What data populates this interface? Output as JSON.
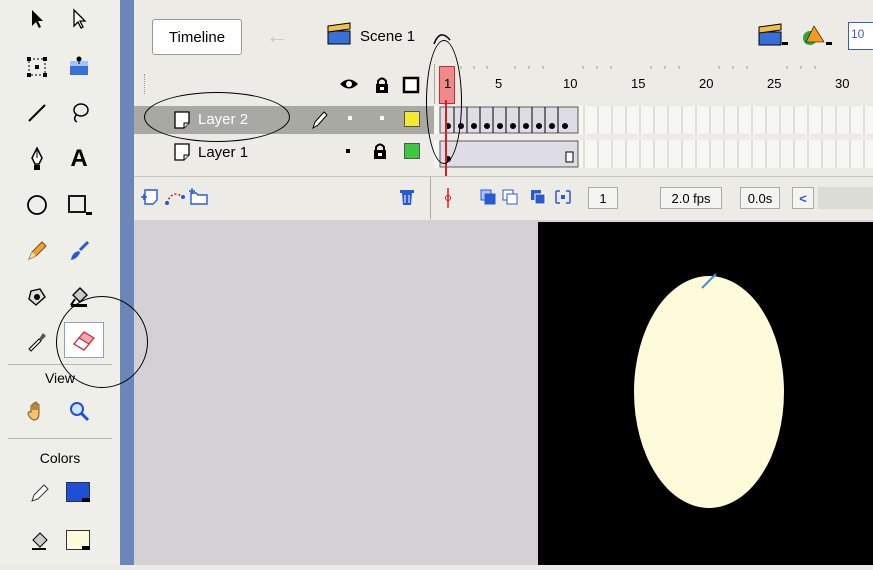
{
  "toolbox": {
    "tools": [
      {
        "name": "arrow-tool-icon"
      },
      {
        "name": "subselect-tool-icon"
      },
      {
        "name": "free-transform-tool-icon"
      },
      {
        "name": "fill-transform-tool-icon"
      },
      {
        "name": "line-tool-icon"
      },
      {
        "name": "lasso-tool-icon"
      },
      {
        "name": "pen-tool-icon"
      },
      {
        "name": "text-tool-icon",
        "glyph": "A"
      },
      {
        "name": "oval-tool-icon"
      },
      {
        "name": "rectangle-tool-icon"
      },
      {
        "name": "pencil-tool-icon"
      },
      {
        "name": "brush-tool-icon"
      },
      {
        "name": "ink-bottle-tool-icon"
      },
      {
        "name": "paint-bucket-tool-icon"
      },
      {
        "name": "eyedropper-tool-icon"
      },
      {
        "name": "eraser-tool-icon",
        "selected": true
      }
    ],
    "view_label": "View",
    "view_tools": [
      {
        "name": "hand-tool-icon"
      },
      {
        "name": "zoom-tool-icon"
      }
    ],
    "colors_label": "Colors",
    "stroke_color": "#1f4fd6",
    "fill_color": "#fdfbd9"
  },
  "header": {
    "timeline_tab": "Timeline",
    "scene_label": "Scene 1",
    "zoom_value": "10"
  },
  "timeline": {
    "ruler_numbers": [
      "1",
      "5",
      "10",
      "15",
      "20",
      "25",
      "30"
    ],
    "layers": [
      {
        "name": "Layer 2",
        "selected": true,
        "outline_color": "#f5e930"
      },
      {
        "name": "Layer 1",
        "selected": false,
        "outline_color": "#3cc83c"
      }
    ],
    "status": {
      "current_frame": "1",
      "frame_rate": "2.0 fps",
      "elapsed": "0.0s"
    }
  },
  "stage": {
    "background": "#000000",
    "shape_fill": "#fdfbd9",
    "stroke_color": "#4a8fd6"
  }
}
